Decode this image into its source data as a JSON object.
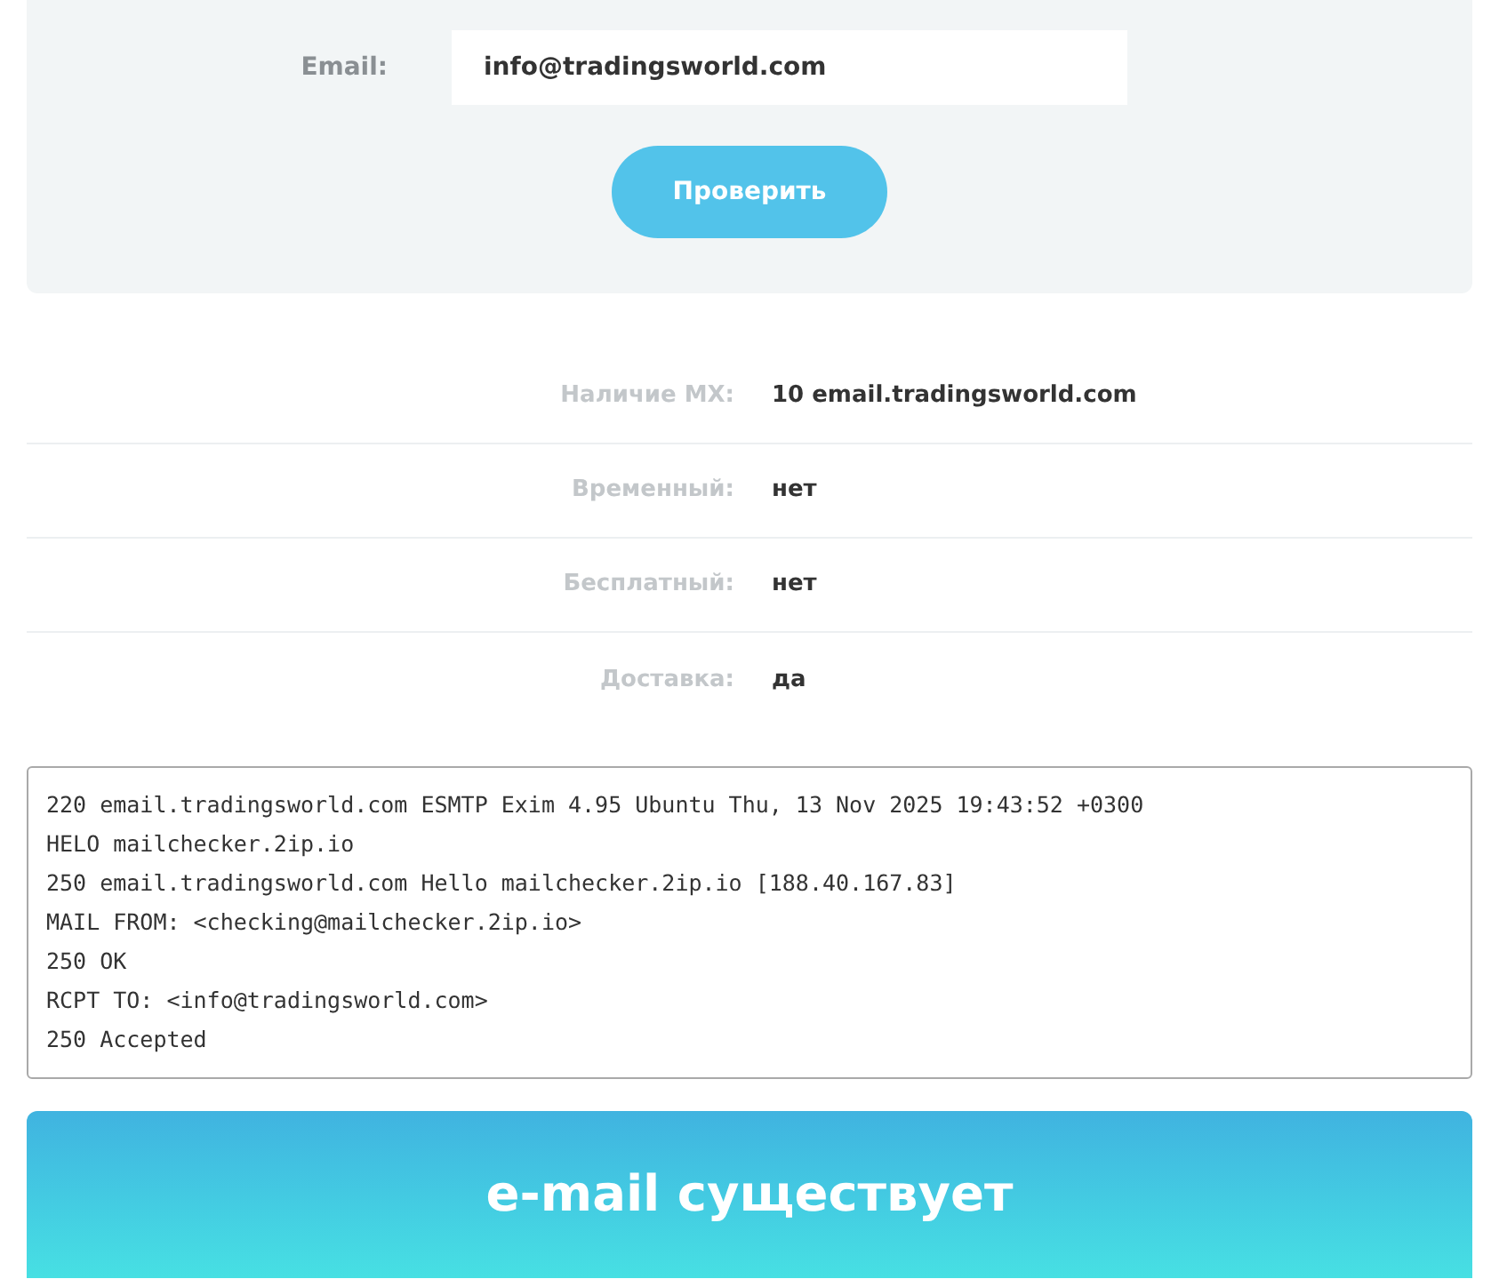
{
  "form": {
    "email_label": "Email:",
    "email_value": "info@tradingsworld.com",
    "check_button": "Проверить"
  },
  "results": [
    {
      "label": "Наличие MX:",
      "value": "10 email.tradingsworld.com"
    },
    {
      "label": "Временный:",
      "value": "нет"
    },
    {
      "label": "Бесплатный:",
      "value": "нет"
    },
    {
      "label": "Доставка:",
      "value": "да"
    }
  ],
  "smtp_log": [
    "220 email.tradingsworld.com ESMTP Exim 4.95 Ubuntu Thu, 13 Nov 2025 19:43:52 +0300",
    "HELO mailchecker.2ip.io",
    "250 email.tradingsworld.com Hello mailchecker.2ip.io [188.40.167.83]",
    "MAIL FROM: <checking@mailchecker.2ip.io>",
    "250 OK",
    "RCPT TO: <info@tradingsworld.com>",
    "250 Accepted"
  ],
  "verdict": "e-mail существует"
}
